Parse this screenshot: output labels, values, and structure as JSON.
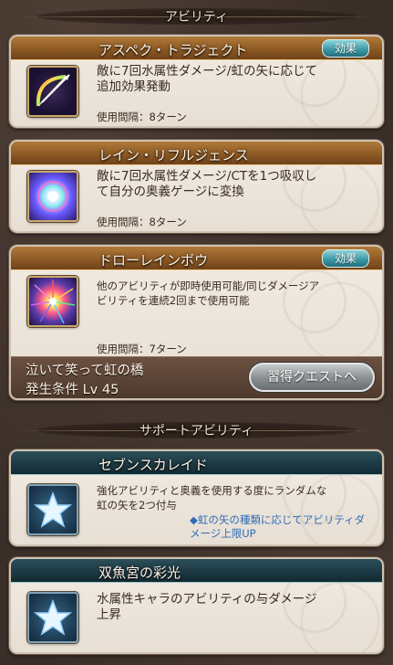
{
  "sections": {
    "ability_header": "アビリティ",
    "support_header": "サポートアビリティ"
  },
  "abilities": [
    {
      "name": "アスペク・トラジェクト",
      "badge": "効果",
      "desc": "敵に7回水属性ダメージ/虹の矢に応じて\n追加効果発動",
      "cooldown": "使用間隔：8ターン",
      "icon": "rainbow-bow-icon"
    },
    {
      "name": "レイン・リフルジェンス",
      "desc": "敵に7回水属性ダメージ/CTを1つ吸収し\nて自分の奥義ゲージに変換",
      "cooldown": "使用間隔：8ターン",
      "icon": "rainbow-orb-icon"
    },
    {
      "name": "ドローレインボウ",
      "badge": "効果",
      "desc": "他のアビリティが即時使用可能/同じダメージア\nビリティを連続2回まで使用可能",
      "cooldown": "使用間隔：7ターン",
      "icon": "rainbow-burst-icon",
      "unlock_quest": "泣いて笑って虹の橋",
      "unlock_condition": "発生条件 Lv 45",
      "quest_button": "習得クエストへ"
    }
  ],
  "support": [
    {
      "name": "セブンスカレイド",
      "desc": "強化アビリティと奥義を使用する度にランダムな\n虹の矢を2つ付与",
      "note": "◆虹の矢の種類に応じてアビリティダメージ上限UP",
      "icon": "star-icon"
    },
    {
      "name": "双魚宮の彩光",
      "desc": "水属性キャラのアビリティの与ダメージ\n上昇",
      "icon": "star-icon"
    }
  ],
  "colors": {
    "gold_bar": "#8e5a24",
    "teal_bar": "#1d3a44",
    "badge": "#3e9aa6",
    "note_blue": "#2f6cb7"
  }
}
